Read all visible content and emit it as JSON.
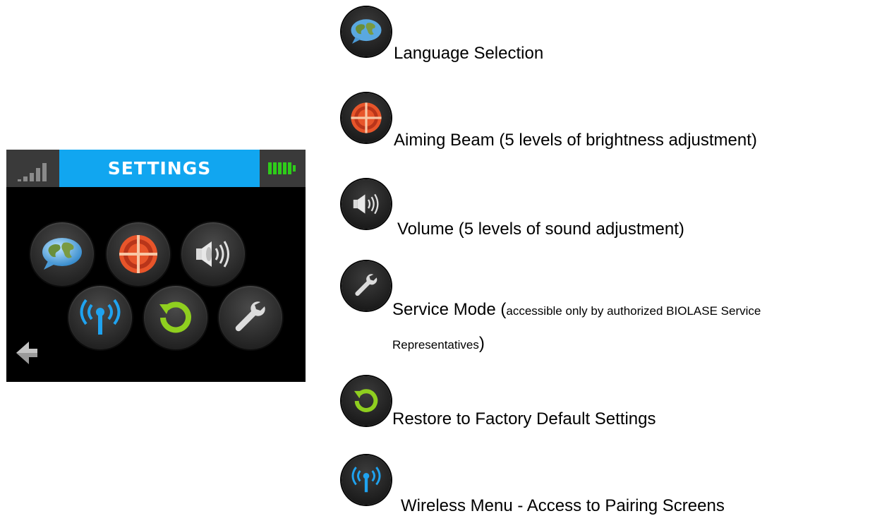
{
  "screen": {
    "title": "SETTINGS",
    "colors": {
      "title_bar": "#11a6f0",
      "background": "#000000",
      "battery": "#2ecc1a",
      "wireless": "#1fa3f0",
      "target": "#e8552a",
      "restore": "#8fcf1f"
    },
    "buttons": [
      {
        "icon": "globe-speech-icon"
      },
      {
        "icon": "target-icon"
      },
      {
        "icon": "speaker-icon"
      },
      {
        "icon": "wireless-icon"
      },
      {
        "icon": "restore-icon"
      },
      {
        "icon": "wrench-icon"
      }
    ],
    "back_icon": "back-arrow-icon"
  },
  "legend": {
    "language": "Language Selection",
    "aiming": "Aiming Beam (5 levels of brightness adjustment)",
    "volume": "Volume (5 levels of sound adjustment)",
    "service_main": "Service Mode (",
    "service_small_1": "accessible only by authorized BIOLASE Service",
    "service_small_2": "Representatives",
    "service_close": ")",
    "restore": "Restore to Factory Default Settings",
    "wireless": "Wireless Menu - Access to Pairing Screens"
  }
}
